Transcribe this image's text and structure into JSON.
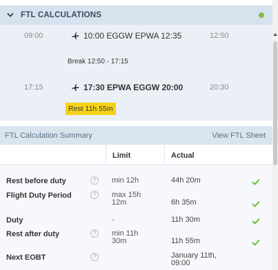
{
  "header": {
    "title": "FTL CALCULATIONS",
    "status_color": "#7ec04f"
  },
  "flights": [
    {
      "time_left": "09:00",
      "leg": "10:00 EGGW EPWA 12:35",
      "time_right": "12:50",
      "bold": false
    },
    {
      "time_left": "17:15",
      "leg": "17:30 EPWA EGGW 20:00",
      "time_right": "20:30",
      "bold": true
    }
  ],
  "break_text": "Break 12:50 - 17:15",
  "rest_badge": "Rest 11h 55m",
  "summary": {
    "title": "FTL Calculation Summary",
    "view_link": "View FTL Sheet",
    "col_limit": "Limit",
    "col_actual": "Actual",
    "rows": [
      {
        "label": "Rest before duty",
        "limit": "min 12h",
        "actual": "44h 20m",
        "check": true
      },
      {
        "label": "Flight Duty Period",
        "limit": "max 15h 12m",
        "actual": "6h 35m",
        "check": true
      },
      {
        "label": "Duty",
        "limit": "-",
        "actual": "11h 30m",
        "check": true
      },
      {
        "label": "Rest after duty",
        "limit": "min 11h 30m",
        "actual": "11h 55m",
        "check": true
      },
      {
        "label": "Next EOBT",
        "limit": "",
        "actual": "January 11th, 09:00",
        "check": false
      }
    ]
  }
}
